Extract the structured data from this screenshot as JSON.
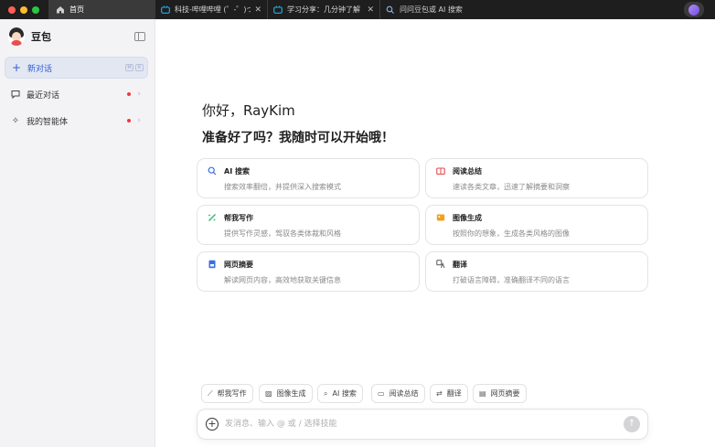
{
  "window": {
    "tabs": [
      {
        "label": "首页",
        "icon": "home-icon"
      },
      {
        "label": "科技-哔哩哔哩 (゜-゜)つ",
        "icon": "bilibili-icon"
      },
      {
        "label": "学习分享：几分钟了解",
        "icon": "bilibili-icon"
      },
      {
        "label": "问问豆包或 AI 搜索",
        "icon": "search-icon"
      }
    ]
  },
  "sidebar": {
    "brand": "豆包",
    "items": [
      {
        "label": "新对话",
        "icon": "plus-icon",
        "shortcut": [
          "⌘",
          "K"
        ]
      },
      {
        "label": "最近对话",
        "icon": "chat-bubble-icon"
      },
      {
        "label": "我的智能体",
        "icon": "sparkle-icon"
      }
    ]
  },
  "main": {
    "greeting": "你好，RayKim",
    "subgreeting": "准备好了吗？我随时可以开始哦！",
    "cards": [
      {
        "title": "AI 搜索",
        "desc": "搜索效率翻倍，并提供深入搜索模式",
        "icon": "ai-search-icon"
      },
      {
        "title": "阅读总结",
        "desc": "速读各类文章，迅速了解摘要和洞察",
        "icon": "book-icon"
      },
      {
        "title": "帮我写作",
        "desc": "提供写作灵感，驾驭各类体裁和风格",
        "icon": "pen-icon"
      },
      {
        "title": "图像生成",
        "desc": "按照你的想象，生成各类风格的图像",
        "icon": "image-icon"
      },
      {
        "title": "网页摘要",
        "desc": "解读网页内容，高效地获取关键信息",
        "icon": "webpage-icon"
      },
      {
        "title": "翻译",
        "desc": "打破语言障碍，准确翻译不同的语言",
        "icon": "translate-icon"
      }
    ],
    "chips": [
      {
        "label": "帮我写作",
        "icon": "pen-icon"
      },
      {
        "label": "图像生成",
        "icon": "image-icon"
      },
      {
        "label": "AI 搜索",
        "icon": "ai-search-icon"
      },
      {
        "label": "阅读总结",
        "icon": "book-icon"
      },
      {
        "label": "翻译",
        "icon": "translate-icon"
      },
      {
        "label": "网页摘要",
        "icon": "webpage-icon"
      }
    ],
    "composer": {
      "placeholder": "发消息、输入 @ 或 / 选择技能"
    }
  },
  "colors": {
    "accent": "#2f5bd9",
    "notification": "#f0383b",
    "ai_search": "#3a6fe8",
    "reading": "#e5484d",
    "writing": "#2fb36a",
    "image": "#f0a020",
    "webpage": "#3a6fe8",
    "translate": "#555555"
  }
}
